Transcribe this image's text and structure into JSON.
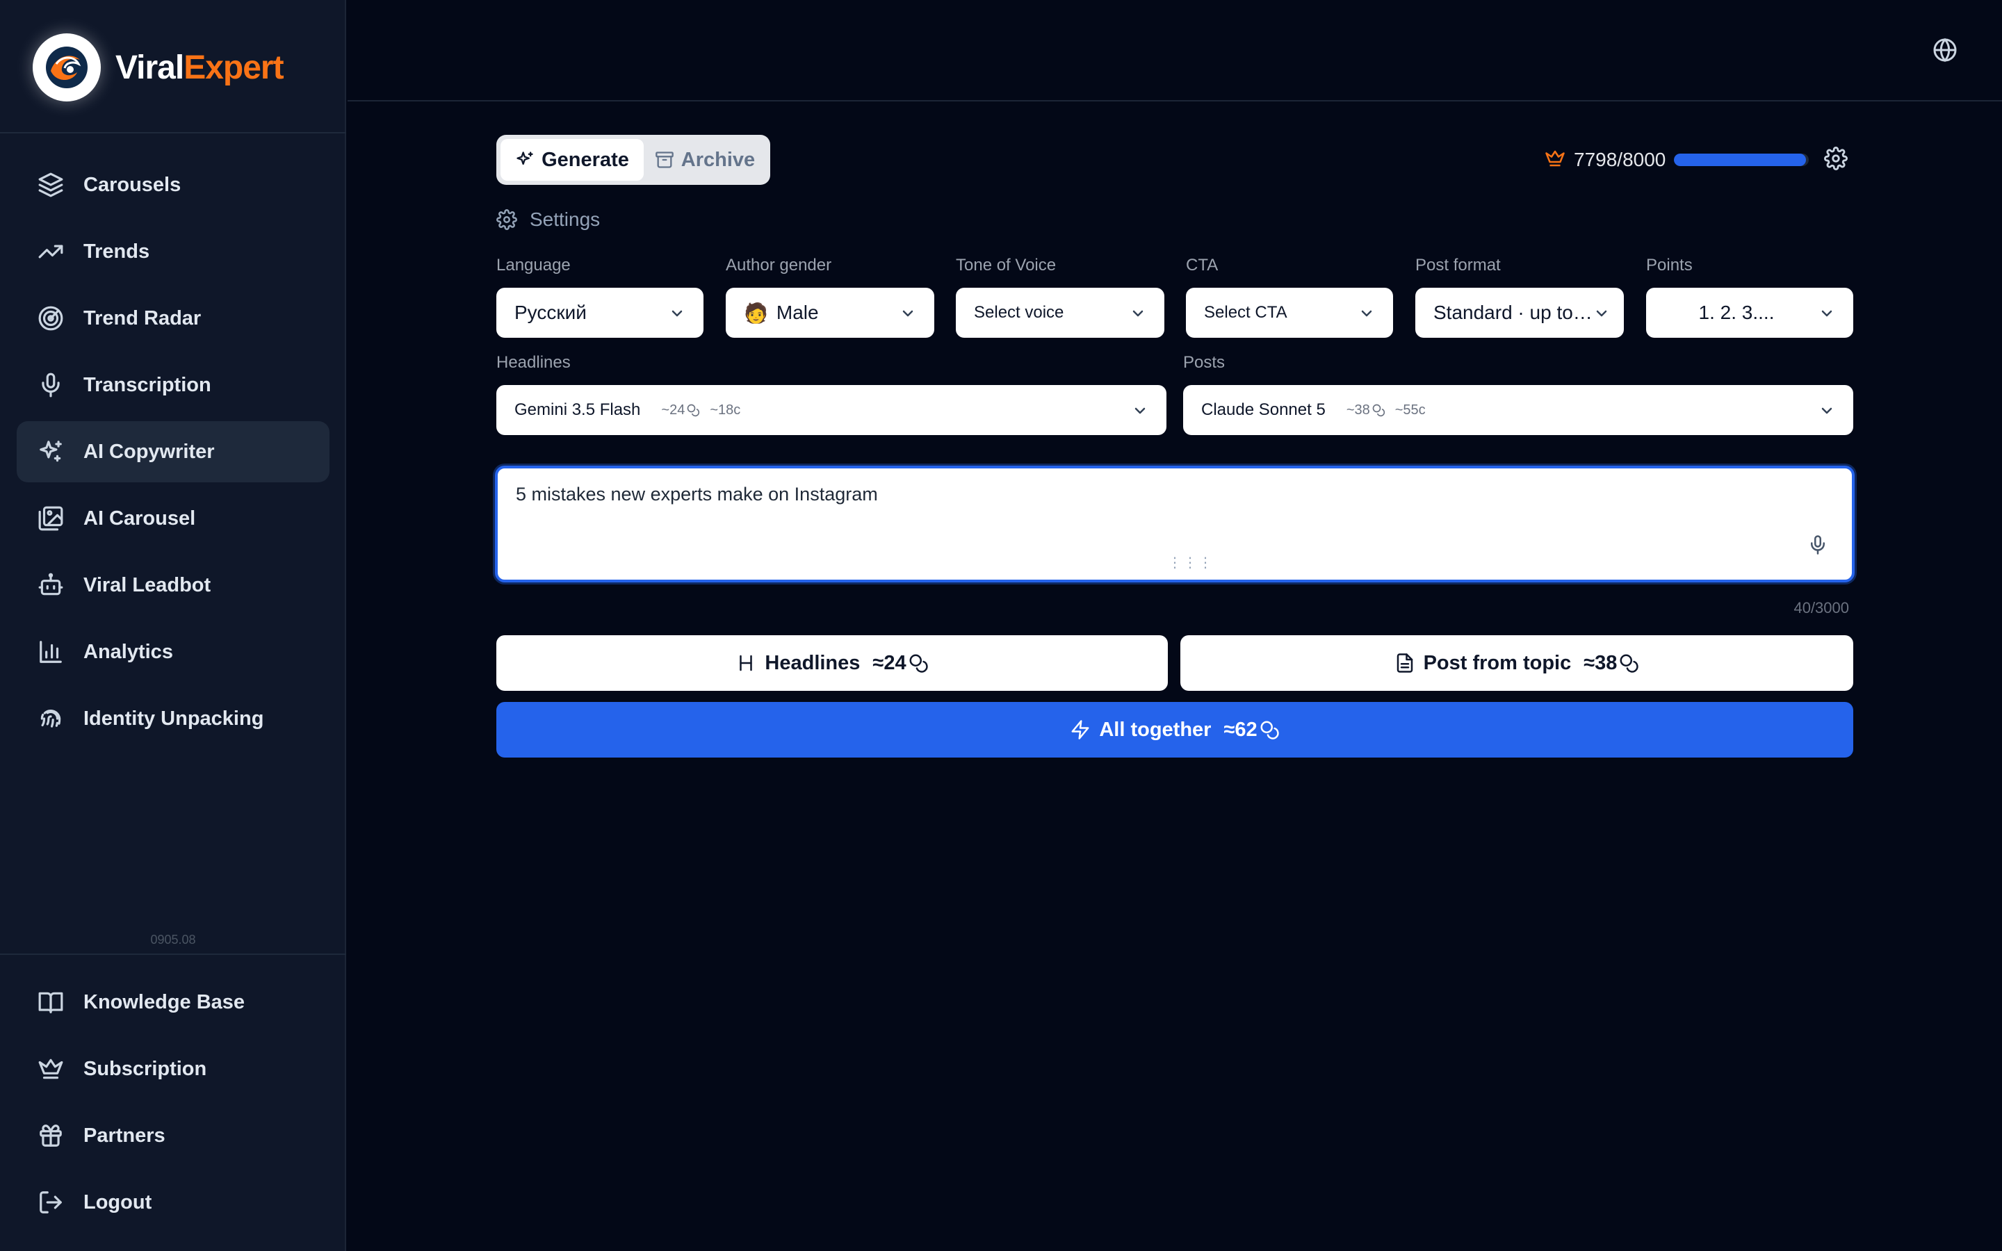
{
  "brand": {
    "name_part1": "Viral",
    "name_part2": "Expert"
  },
  "sidebar": {
    "items": [
      {
        "label": "Carousels",
        "icon": "layers-icon"
      },
      {
        "label": "Trends",
        "icon": "trending-up-icon"
      },
      {
        "label": "Trend Radar",
        "icon": "radar-icon"
      },
      {
        "label": "Transcription",
        "icon": "microphone-icon"
      },
      {
        "label": "AI Copywriter",
        "icon": "sparkles-icon",
        "active": true
      },
      {
        "label": "AI Carousel",
        "icon": "images-icon"
      },
      {
        "label": "Viral Leadbot",
        "icon": "bot-icon"
      },
      {
        "label": "Analytics",
        "icon": "bar-chart-icon"
      },
      {
        "label": "Identity Unpacking",
        "icon": "fingerprint-icon"
      }
    ],
    "version": "0905.08",
    "bottom_items": [
      {
        "label": "Knowledge Base",
        "icon": "book-icon"
      },
      {
        "label": "Subscription",
        "icon": "crown-icon"
      },
      {
        "label": "Partners",
        "icon": "gift-icon"
      },
      {
        "label": "Logout",
        "icon": "logout-icon"
      }
    ]
  },
  "tabs": {
    "generate": "Generate",
    "archive": "Archive"
  },
  "quota": {
    "text": "7798/8000",
    "used_fraction": 0.975
  },
  "settings": {
    "title": "Settings",
    "language": {
      "label": "Language",
      "value": "Русский"
    },
    "gender": {
      "label": "Author gender",
      "emoji": "🧑",
      "value": "Male"
    },
    "tone": {
      "label": "Tone of Voice",
      "value": "Select voice"
    },
    "cta": {
      "label": "CTA",
      "value": "Select CTA"
    },
    "format": {
      "label": "Post format",
      "value": "Standard · up to…"
    },
    "points": {
      "label": "Points",
      "value": "1. 2. 3...."
    },
    "headlines": {
      "label": "Headlines",
      "model": "Gemini 3.5 Flash",
      "cost": "~24",
      "cents": "~18c"
    },
    "posts": {
      "label": "Posts",
      "model": "Claude Sonnet 5",
      "cost": "~38",
      "cents": "~55c"
    }
  },
  "topic": {
    "value": "5 mistakes new experts make on Instagram",
    "counter": "40/3000"
  },
  "actions": {
    "headlines": {
      "label": "Headlines",
      "cost": "≈24"
    },
    "post": {
      "label": "Post from topic",
      "cost": "≈38"
    },
    "all": {
      "label": "All together",
      "cost": "≈62"
    }
  },
  "colors": {
    "accent": "#2563eb",
    "brand_orange": "#f97316",
    "background": "#030817",
    "sidebar": "#0f1729"
  }
}
